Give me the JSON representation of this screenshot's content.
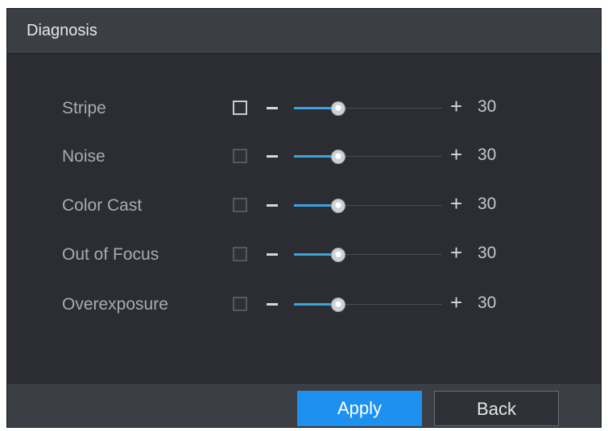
{
  "dialog": {
    "title": "Diagnosis"
  },
  "rows": [
    {
      "label": "Stripe",
      "checked": false,
      "value": "30",
      "level_percent": 30
    },
    {
      "label": "Noise",
      "checked": false,
      "value": "30",
      "level_percent": 30
    },
    {
      "label": "Color Cast",
      "checked": false,
      "value": "30",
      "level_percent": 30
    },
    {
      "label": "Out of Focus",
      "checked": false,
      "value": "30",
      "level_percent": 30
    },
    {
      "label": "Overexposure",
      "checked": false,
      "value": "30",
      "level_percent": 30
    }
  ],
  "controls": {
    "minus_symbol": "−",
    "plus_symbol": "+"
  },
  "footer": {
    "apply_label": "Apply",
    "back_label": "Back"
  },
  "colors": {
    "accent": "#1e90f0",
    "slider_fill": "#3aa3e0"
  }
}
